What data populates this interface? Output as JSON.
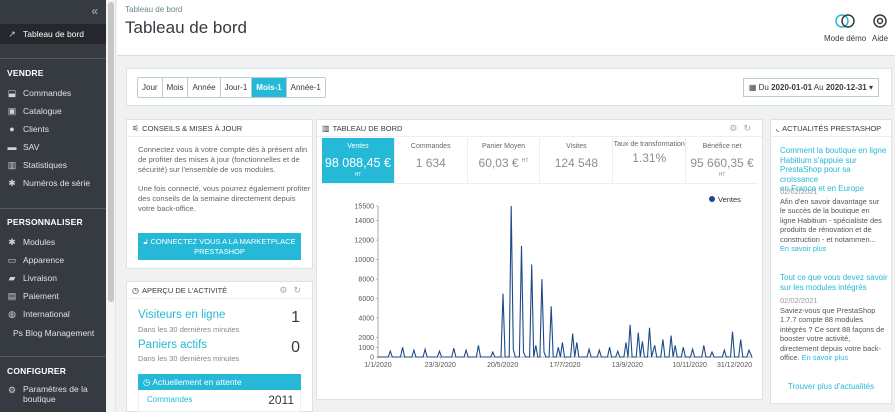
{
  "sidebar": {
    "collapse_icon": "«",
    "active_item": "Tableau de bord",
    "sections": {
      "vendre": "VENDRE",
      "personnaliser": "PERSONNALISER",
      "configurer": "CONFIGURER"
    },
    "items": {
      "commandes": "Commandes",
      "catalogue": "Catalogue",
      "clients": "Clients",
      "sav": "SAV",
      "statistiques": "Statistiques",
      "numeros": "Numéros de série",
      "modules": "Modules",
      "apparence": "Apparence",
      "livraison": "Livraison",
      "paiement": "Paiement",
      "international": "International",
      "blog": "Ps Blog Management",
      "parametres_1": "Paramètres de la",
      "parametres_2": "boutique"
    }
  },
  "header": {
    "breadcrumb": "Tableau de bord",
    "title": "Tableau de bord",
    "demo_label": "Mode démo",
    "help_label": "Aide"
  },
  "toolbar": {
    "periods": [
      "Jour",
      "Mois",
      "Année",
      "Jour-1",
      "Mois-1",
      "Année-1"
    ],
    "active_period": "Mois-1",
    "date_prefix": "Du",
    "date_from": "2020-01-01",
    "date_mid": "Au",
    "date_to": "2020-12-31"
  },
  "tips": {
    "title": "CONSEILS & MISES À JOUR",
    "p1": [
      "Connectez vous à votre compte dès à présent afin",
      "de profiter des mises à jour (fonctionnelles et de",
      "sécurité) sur l'ensemble de vos modules."
    ],
    "p2": [
      "Une fois connecté, vous pourrez également profiter",
      "des conseils de la semaine directement depuis",
      "votre back-office."
    ],
    "button_1": "CONNECTEZ VOUS A LA MARKETPLACE",
    "button_2": "PRESTASHOP"
  },
  "activity": {
    "title": "APERÇU DE L'ACTIVITÉ",
    "visitors_label": "Visiteurs en ligne",
    "visitors_sub": "Dans les 30 dernières minutes",
    "visitors_value": "1",
    "carts_label": "Paniers actifs",
    "carts_sub": "Dans les 30 dernières minutes",
    "carts_value": "0",
    "pending_label": "Actuellement en attente",
    "orders_label": "Commandes",
    "orders_value": "2011"
  },
  "dashboard": {
    "title": "TABLEAU DE BORD",
    "kpis": [
      {
        "label": "Ventes",
        "value": "98 088,45 €",
        "suffix": "HT"
      },
      {
        "label": "Commandes",
        "value": "1 634",
        "suffix": ""
      },
      {
        "label": "Panier Moyen",
        "value": "60,03 €",
        "suffix": "HT"
      },
      {
        "label": "Visites",
        "value": "124 548",
        "suffix": ""
      },
      {
        "label": "Taux de transformation",
        "value": "1.31%",
        "suffix": ""
      },
      {
        "label": "Bénéfice net",
        "value": "95 660,35 €",
        "suffix": "HT"
      }
    ]
  },
  "news": {
    "title": "ACTUALITÉS PRESTASHOP",
    "item1_title": [
      "Comment la boutique en ligne",
      "Habitium s'appuie sur",
      "PrestaShop pour sa croissance",
      "en France et en Europe"
    ],
    "item1_date": "02/02/2021",
    "item1_body": [
      "Afin d'en savoir davantage sur",
      "le succès de la boutique en",
      "ligne Habitium - spécialiste des",
      "produits de rénovation et de",
      "construction - et notammen..."
    ],
    "item1_more": "En savoir plus",
    "item2_title": [
      "Tout ce que vous devez savoir",
      "sur les modules intégrés"
    ],
    "item2_date": "02/02/2021",
    "item2_body": [
      "Saviez-vous que PrestaShop",
      "1.7.7 compte 88 modules",
      "intégrés ? Ce sont 88 façons de",
      "booster votre activité,",
      "directement depuis votre back-"
    ],
    "item2_body_last": "office.",
    "item2_more": "En savoir plus",
    "all_link": "Trouver plus d'actualités"
  },
  "chart_data": {
    "type": "line",
    "series": [
      {
        "name": "Ventes",
        "color": "#1f4a8a"
      }
    ],
    "x_ticks": [
      "1/1/2020",
      "23/3/2020",
      "20/5/2020",
      "17/7/2020",
      "13/9/2020",
      "10/11/2020",
      "31/12/2020"
    ],
    "y_ticks": [
      0,
      1000,
      2000,
      4000,
      6000,
      8000,
      10000,
      12000,
      14000,
      15500
    ],
    "ylim": [
      0,
      15500
    ],
    "xlim": [
      0,
      365
    ],
    "points": [
      [
        0,
        0
      ],
      [
        10,
        0
      ],
      [
        12,
        600
      ],
      [
        14,
        0
      ],
      [
        22,
        0
      ],
      [
        24,
        1000
      ],
      [
        26,
        0
      ],
      [
        33,
        0
      ],
      [
        35,
        700
      ],
      [
        37,
        0
      ],
      [
        44,
        0
      ],
      [
        46,
        800
      ],
      [
        48,
        0
      ],
      [
        58,
        0
      ],
      [
        60,
        600
      ],
      [
        62,
        0
      ],
      [
        72,
        0
      ],
      [
        74,
        900
      ],
      [
        76,
        0
      ],
      [
        84,
        0
      ],
      [
        86,
        700
      ],
      [
        88,
        0
      ],
      [
        96,
        0
      ],
      [
        98,
        1200
      ],
      [
        100,
        0
      ],
      [
        110,
        0
      ],
      [
        112,
        500
      ],
      [
        114,
        0
      ],
      [
        120,
        0
      ],
      [
        122,
        6500
      ],
      [
        124,
        0
      ],
      [
        128,
        0
      ],
      [
        130,
        15500
      ],
      [
        132,
        800
      ],
      [
        134,
        0
      ],
      [
        138,
        0
      ],
      [
        140,
        11400
      ],
      [
        142,
        500
      ],
      [
        144,
        0
      ],
      [
        148,
        0
      ],
      [
        150,
        9500
      ],
      [
        152,
        0
      ],
      [
        154,
        1200
      ],
      [
        156,
        0
      ],
      [
        158,
        0
      ],
      [
        160,
        8000
      ],
      [
        162,
        500
      ],
      [
        164,
        0
      ],
      [
        167,
        0
      ],
      [
        169,
        5200
      ],
      [
        171,
        0
      ],
      [
        174,
        0
      ],
      [
        176,
        1000
      ],
      [
        178,
        0
      ],
      [
        180,
        1500
      ],
      [
        182,
        0
      ],
      [
        188,
        0
      ],
      [
        190,
        2400
      ],
      [
        192,
        0
      ],
      [
        194,
        1500
      ],
      [
        196,
        0
      ],
      [
        204,
        0
      ],
      [
        206,
        800
      ],
      [
        208,
        0
      ],
      [
        214,
        0
      ],
      [
        216,
        700
      ],
      [
        218,
        0
      ],
      [
        224,
        0
      ],
      [
        226,
        1000
      ],
      [
        228,
        0
      ],
      [
        232,
        0
      ],
      [
        234,
        600
      ],
      [
        236,
        0
      ],
      [
        240,
        0
      ],
      [
        242,
        1500
      ],
      [
        244,
        0
      ],
      [
        246,
        3300
      ],
      [
        248,
        0
      ],
      [
        252,
        0
      ],
      [
        254,
        2500
      ],
      [
        256,
        0
      ],
      [
        258,
        1600
      ],
      [
        260,
        0
      ],
      [
        263,
        0
      ],
      [
        265,
        3000
      ],
      [
        267,
        0
      ],
      [
        270,
        1200
      ],
      [
        272,
        0
      ],
      [
        276,
        0
      ],
      [
        278,
        1800
      ],
      [
        280,
        0
      ],
      [
        284,
        0
      ],
      [
        286,
        2200
      ],
      [
        288,
        0
      ],
      [
        290,
        1200
      ],
      [
        292,
        0
      ],
      [
        296,
        0
      ],
      [
        298,
        1000
      ],
      [
        300,
        0
      ],
      [
        305,
        0
      ],
      [
        307,
        800
      ],
      [
        309,
        0
      ],
      [
        316,
        0
      ],
      [
        318,
        1200
      ],
      [
        320,
        0
      ],
      [
        324,
        0
      ],
      [
        326,
        500
      ],
      [
        328,
        0
      ],
      [
        336,
        0
      ],
      [
        338,
        700
      ],
      [
        340,
        0
      ],
      [
        344,
        0
      ],
      [
        346,
        2600
      ],
      [
        348,
        0
      ],
      [
        352,
        0
      ],
      [
        354,
        1800
      ],
      [
        356,
        0
      ],
      [
        360,
        0
      ],
      [
        362,
        700
      ],
      [
        365,
        0
      ]
    ],
    "legend": "top-right",
    "grid": false
  }
}
